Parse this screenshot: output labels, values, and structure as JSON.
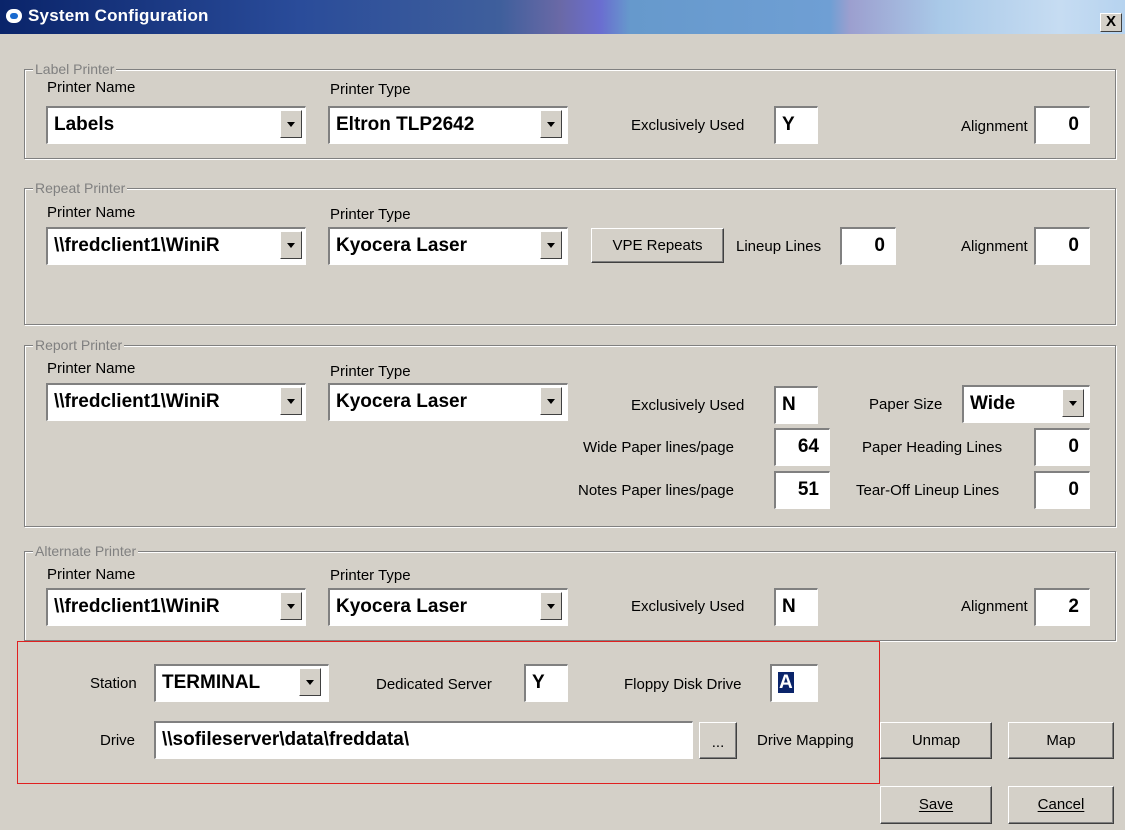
{
  "window": {
    "title": "System Configuration",
    "close_label": "X"
  },
  "label_printer": {
    "legend": "Label Printer",
    "printer_name_label": "Printer Name",
    "printer_name": "Labels",
    "printer_type_label": "Printer Type",
    "printer_type": "Eltron TLP2642",
    "exclusive_label": "Exclusively Used",
    "exclusive": "Y",
    "alignment_label": "Alignment",
    "alignment": "0"
  },
  "repeat_printer": {
    "legend": "Repeat Printer",
    "printer_name_label": "Printer Name",
    "printer_name": "\\\\fredclient1\\WiniR",
    "printer_type_label": "Printer Type",
    "printer_type": "Kyocera Laser",
    "vpe_button": "VPE Repeats",
    "lineup_label": "Lineup Lines",
    "lineup": "0",
    "alignment_label": "Alignment",
    "alignment": "0"
  },
  "report_printer": {
    "legend": "Report Printer",
    "printer_name_label": "Printer Name",
    "printer_name": "\\\\fredclient1\\WiniR",
    "printer_type_label": "Printer Type",
    "printer_type": "Kyocera Laser",
    "exclusive_label": "Exclusively Used",
    "exclusive": "N",
    "paper_size_label": "Paper Size",
    "paper_size": "Wide",
    "wide_lines_label": "Wide Paper lines/page",
    "wide_lines": "64",
    "heading_lines_label": "Paper Heading Lines",
    "heading_lines": "0",
    "notes_lines_label": "Notes Paper lines/page",
    "notes_lines": "51",
    "tearoff_label": "Tear-Off Lineup Lines",
    "tearoff": "0"
  },
  "alternate_printer": {
    "legend": "Alternate Printer",
    "printer_name_label": "Printer Name",
    "printer_name": "\\\\fredclient1\\WiniR",
    "printer_type_label": "Printer Type",
    "printer_type": "Kyocera Laser",
    "exclusive_label": "Exclusively Used",
    "exclusive": "N",
    "alignment_label": "Alignment",
    "alignment": "2"
  },
  "station": {
    "station_label": "Station",
    "station": "TERMINAL",
    "server_label": "Dedicated Server",
    "server": "Y",
    "floppy_label": "Floppy Disk Drive",
    "floppy": "A",
    "drive_label": "Drive",
    "drive": "\\\\sofileserver\\data\\freddata\\",
    "browse_button": "...",
    "mapping_label": "Drive Mapping",
    "unmap_button": "Unmap",
    "map_button": "Map"
  },
  "footer": {
    "save_button": "Save",
    "cancel_button": "Cancel"
  },
  "colors": {
    "highlight_border": "#e02020",
    "title_bar_start": "#0a246a"
  }
}
